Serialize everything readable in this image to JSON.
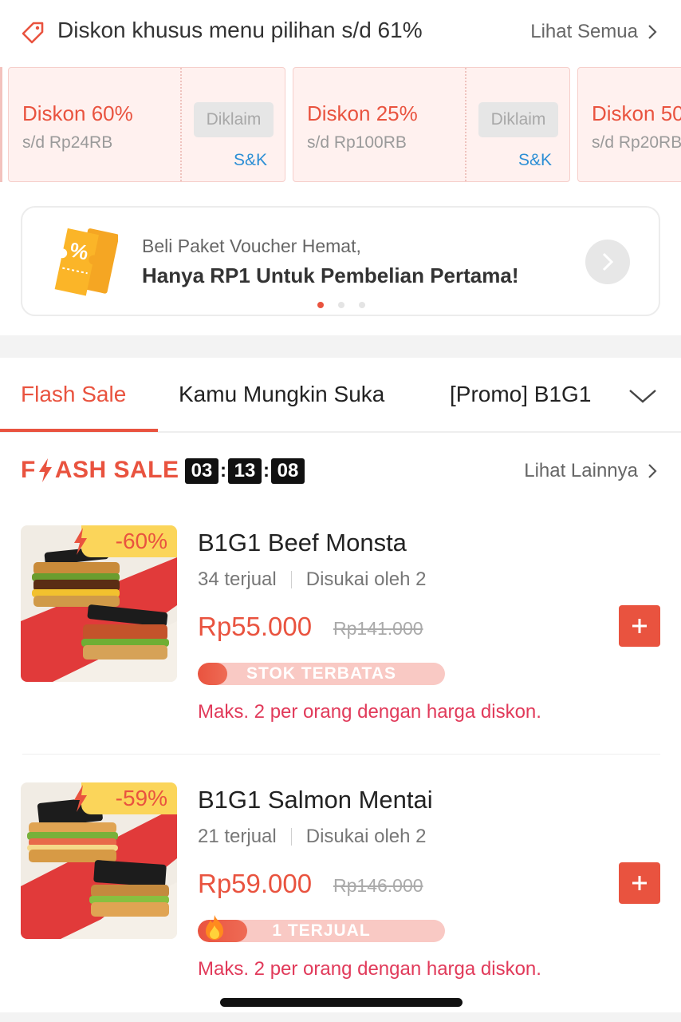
{
  "promo": {
    "title": "Diskon khusus menu pilihan s/d 61%",
    "see_all": "Lihat Semua",
    "icon": "tag-icon"
  },
  "vouchers": [
    {
      "title": "Diskon 60%",
      "sub": "s/d Rp24RB",
      "claim": "Diklaim",
      "terms": "S&K"
    },
    {
      "title": "Diskon 25%",
      "sub": "s/d Rp100RB",
      "claim": "Diklaim",
      "terms": "S&K"
    },
    {
      "title": "Diskon 50",
      "sub": "s/d Rp20RB",
      "claim": "",
      "terms": ""
    }
  ],
  "banner": {
    "line1": "Beli Paket Voucher Hemat,",
    "line2": "Hanya RP1 Untuk Pembelian Pertama!",
    "icon": "voucher-ticket-icon"
  },
  "tabs": [
    {
      "label": "Flash Sale",
      "active": true
    },
    {
      "label": "Kamu Mungkin Suka",
      "active": false
    },
    {
      "label": "[Promo] B1G1",
      "active": false
    }
  ],
  "flash_sale": {
    "logo_f": "F",
    "logo_rest": "ASH SALE",
    "countdown": {
      "hours": "03",
      "minutes": "13",
      "seconds": "08",
      "sep": ":"
    },
    "see_more": "Lihat Lainnya"
  },
  "products": [
    {
      "badge": "-60%",
      "name": "B1G1 Beef Monsta",
      "sold": "34 terjual",
      "liked": "Disukai oleh 2",
      "price": "Rp55.000",
      "old_price": "Rp141.000",
      "stock_label": "STOK TERBATAS",
      "stock_level": 0.12,
      "limit": "Maks. 2 per orang dengan harga diskon."
    },
    {
      "badge": "-59%",
      "name": "B1G1 Salmon Mentai",
      "sold": "21 terjual",
      "liked": "Disukai oleh 2",
      "price": "Rp59.000",
      "old_price": "Rp146.000",
      "stock_label": "1 TERJUAL",
      "stock_level": 0.2,
      "limit": "Maks. 2 per orang dengan harga diskon."
    }
  ],
  "colors": {
    "accent": "#e9533f",
    "limit_text": "#e13a5a",
    "badge": "#fbd55a",
    "link": "#2d8fd5"
  }
}
